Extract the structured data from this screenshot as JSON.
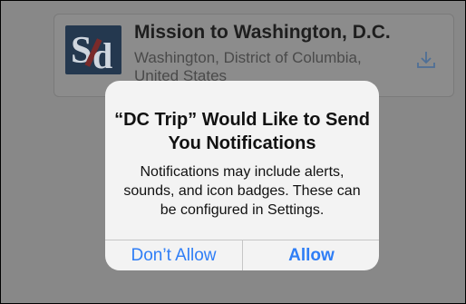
{
  "background_card": {
    "logo_text": "Sd",
    "title": "Mission to Washington, D.C.",
    "subtitle": "Washington, District of Columbia, United States",
    "action_icon": "download-icon"
  },
  "alert": {
    "title": "“DC Trip” Would Like to Send You Notifications",
    "message": "Notifications may include alerts, sounds, and icon badges. These can be configured in Settings.",
    "buttons": {
      "deny_label": "Don’t Allow",
      "allow_label": "Allow"
    }
  },
  "colors": {
    "button_text": "#2f7ef6",
    "alert_bg": "#f3f3f3",
    "dim_overlay": "#888888"
  }
}
